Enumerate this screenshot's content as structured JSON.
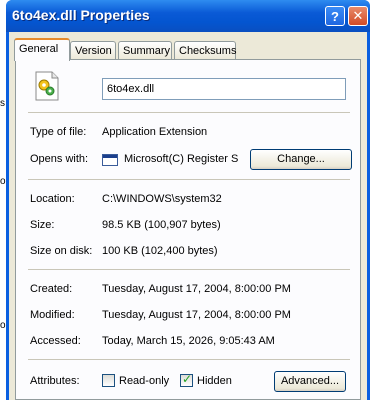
{
  "window": {
    "title": "6to4ex.dll Properties",
    "help_button": "?",
    "close_button": "✕"
  },
  "tabs": [
    {
      "label": "General",
      "active": true
    },
    {
      "label": "Version",
      "active": false
    },
    {
      "label": "Summary",
      "active": false
    },
    {
      "label": "Checksums",
      "active": false
    }
  ],
  "general": {
    "file_name": "6to4ex.dll",
    "type_label": "Type of file:",
    "type_value": "Application Extension",
    "opens_label": "Opens with:",
    "opens_value": "Microsoft(C) Register S",
    "change_button": "Change...",
    "location_label": "Location:",
    "location_value": "C:\\WINDOWS\\system32",
    "size_label": "Size:",
    "size_value": "98.5 KB (100,907 bytes)",
    "size_on_disk_label": "Size on disk:",
    "size_on_disk_value": "100 KB (102,400 bytes)",
    "created_label": "Created:",
    "created_value": "Tuesday, August 17, 2004, 8:00:00 PM",
    "modified_label": "Modified:",
    "modified_value": "Tuesday, August 17, 2004, 8:00:00 PM",
    "accessed_label": "Accessed:",
    "accessed_value": "Today, March 15, 2026, 9:05:43 AM",
    "attributes_label": "Attributes:",
    "readonly_label": "Read-only",
    "readonly_checked": false,
    "hidden_label": "Hidden",
    "hidden_checked": true,
    "advanced_button": "Advanced..."
  },
  "background_letters": [
    "s",
    "or",
    "o."
  ]
}
